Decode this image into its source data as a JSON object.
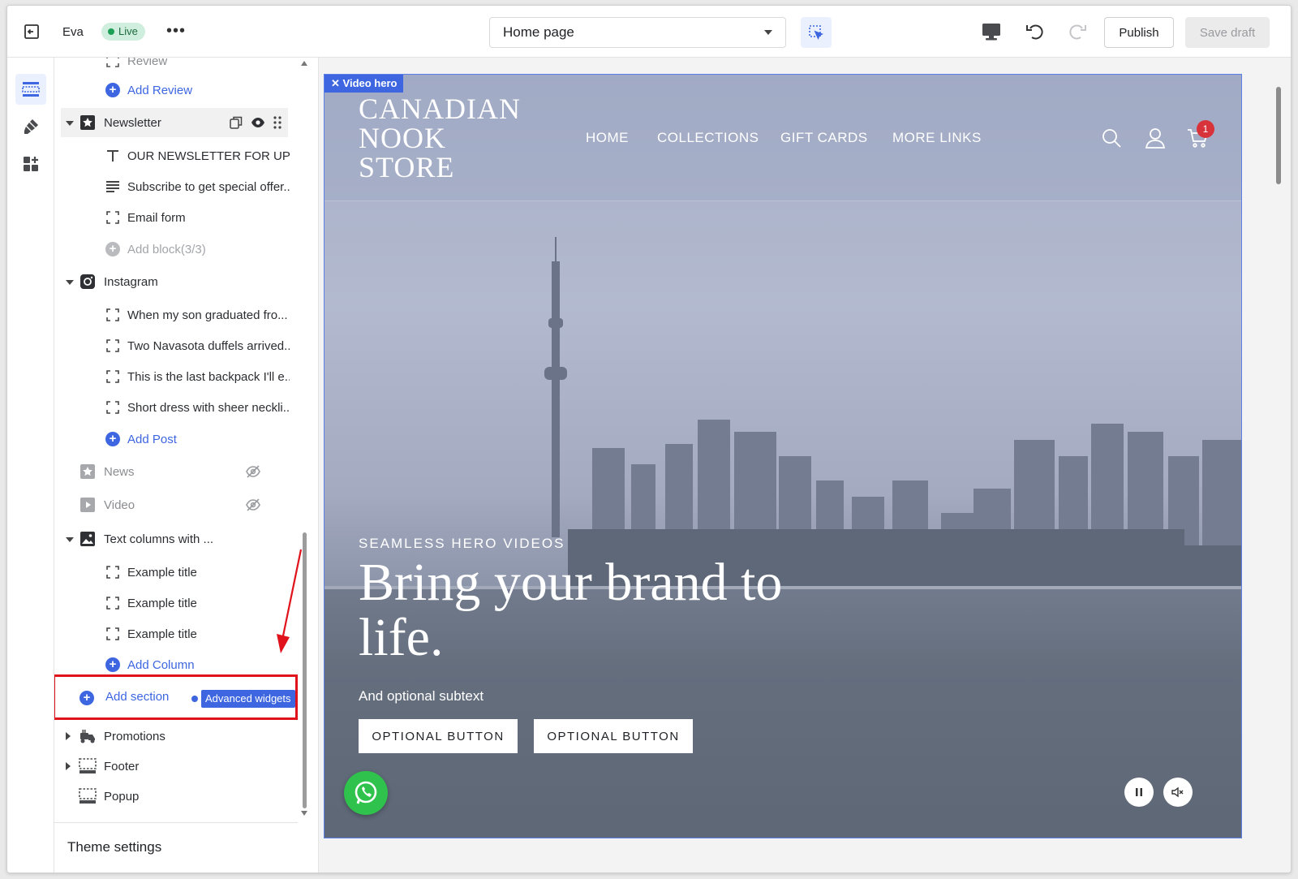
{
  "topbar": {
    "store_name": "Eva",
    "status": "Live",
    "more": "•••",
    "page_select": "Home page",
    "publish": "Publish",
    "save_draft": "Save draft"
  },
  "sidebar": {
    "truncated_top": "Review",
    "add_review": "Add Review",
    "newsletter": {
      "label": "Newsletter",
      "blocks": [
        "OUR NEWSLETTER FOR UPD...",
        "Subscribe to get special offer...",
        "Email form"
      ],
      "add_block": "Add block(3/3)"
    },
    "instagram": {
      "label": "Instagram",
      "blocks": [
        "When my son graduated fro...",
        "Two Navasota duffels arrived...",
        "This is the last backpack I'll e...",
        "Short dress with sheer neckli..."
      ],
      "add_post": "Add Post"
    },
    "news": "News",
    "video": "Video",
    "text_columns": {
      "label": "Text columns with ...",
      "blocks": [
        "Example title",
        "Example title",
        "Example title"
      ],
      "add_column": "Add Column"
    },
    "add_section": "Add section",
    "advanced_widgets": "Advanced widgets",
    "promotions": "Promotions",
    "footer": "Footer",
    "popup": "Popup",
    "theme_settings": "Theme settings"
  },
  "preview": {
    "section_tag": "Video hero",
    "logo": "CANADIAN NOOK STORE",
    "nav": [
      "HOME",
      "COLLECTIONS",
      "GIFT CARDS",
      "MORE LINKS"
    ],
    "cart_count": "1",
    "eyebrow": "SEAMLESS HERO VIDEOS",
    "title": "Bring your brand to life.",
    "subtext": "And optional subtext",
    "button1": "OPTIONAL BUTTON",
    "button2": "OPTIONAL BUTTON"
  },
  "colors": {
    "accent": "#3d66e0",
    "live_bg": "#cfeede",
    "highlight_red": "#e0121b",
    "cart_badge": "#d8323b",
    "whatsapp": "#2fc24c"
  },
  "icons": [
    "exit-icon",
    "inspect-icon",
    "desktop-icon",
    "undo-icon",
    "redo-icon",
    "sections-icon",
    "brush-icon",
    "apps-icon",
    "star-icon",
    "copy-icon",
    "eye-icon",
    "drag-icon",
    "text-icon",
    "paragraph-icon",
    "block-icon",
    "instagram-icon",
    "eye-off-icon",
    "video-icon",
    "image-icon",
    "search-icon",
    "user-icon",
    "cart-icon",
    "pause-icon",
    "mute-icon",
    "whatsapp-icon"
  ]
}
